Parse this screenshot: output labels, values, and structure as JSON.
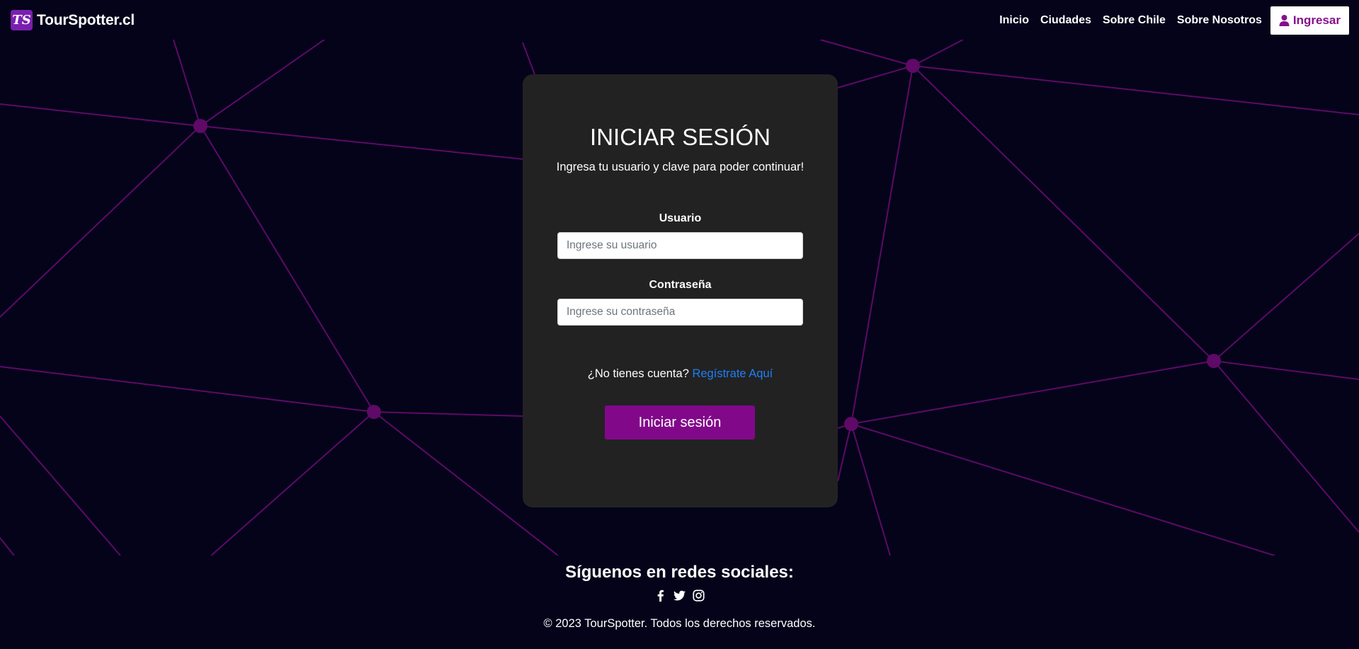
{
  "brand": {
    "logo_text": "TS",
    "name": "TourSpotter.cl"
  },
  "nav": {
    "items": [
      "Inicio",
      "Ciudades",
      "Sobre Chile",
      "Sobre Nosotros"
    ],
    "login_label": "Ingresar"
  },
  "login": {
    "title": "INICIAR SESIÓN",
    "subtitle": "Ingresa tu usuario y clave para poder continuar!",
    "username_label": "Usuario",
    "username_placeholder": "Ingrese su usuario",
    "username_value": "",
    "password_label": "Contraseña",
    "password_placeholder": "Ingrese su contraseña",
    "password_value": "",
    "register_prompt": "¿No tienes cuenta?",
    "register_link": "Regístrate Aquí",
    "submit_label": "Iniciar sesión"
  },
  "footer": {
    "title": "Síguenos en redes sociales:",
    "social_icons": [
      "facebook-icon",
      "twitter-icon",
      "instagram-icon"
    ],
    "copyright": "© 2023 TourSpotter. Todos los derechos reservados."
  },
  "colors": {
    "background": "#04031a",
    "card": "#222222",
    "accent": "#82088a",
    "network_line": "#5e0a66",
    "network_node": "#5e0a66",
    "link": "#1f7ef5"
  }
}
